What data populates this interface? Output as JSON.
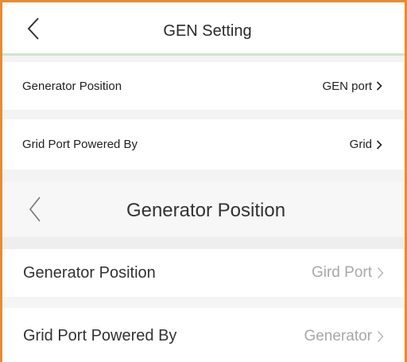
{
  "screen1": {
    "title": "GEN Setting",
    "rows": [
      {
        "label": "Generator Position",
        "value": "GEN port"
      },
      {
        "label": "Grid Port Powered By",
        "value": "Grid"
      }
    ]
  },
  "screen2": {
    "title": "Generator Position",
    "rows": [
      {
        "label": "Generator Position",
        "value": "Gird Port"
      },
      {
        "label": "Grid Port Powered By",
        "value": "Generator"
      }
    ]
  },
  "icons": {
    "back": "chevron-left-icon",
    "row_arrow": "chevron-right-icon"
  },
  "colors": {
    "frame_border": "#f0892a",
    "header_divider": "#cfe6cf",
    "section_gap": "#f3f3f3",
    "muted_value": "#a8a8a8"
  }
}
